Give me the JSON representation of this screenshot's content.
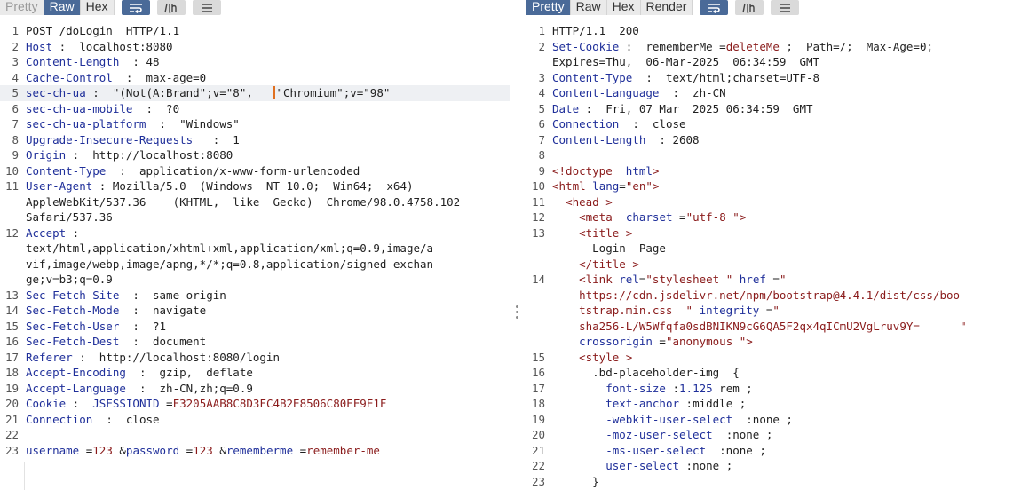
{
  "request": {
    "tabs": [
      "Pretty",
      "Raw",
      "Hex"
    ],
    "active_tab": "Raw",
    "lines": [
      {
        "no": "1",
        "segs": [
          {
            "t": "POST /doLogin  HTTP/1.1"
          }
        ]
      },
      {
        "no": "2",
        "segs": [
          {
            "t": "Host",
            "c": "hn"
          },
          {
            "t": " :  localhost:8080"
          }
        ]
      },
      {
        "no": "3",
        "segs": [
          {
            "t": "Content-Length",
            "c": "hn"
          },
          {
            "t": "  : 48"
          }
        ]
      },
      {
        "no": "4",
        "segs": [
          {
            "t": "Cache-Control",
            "c": "hn"
          },
          {
            "t": "  :  max-age=0"
          }
        ]
      },
      {
        "no": "5",
        "hl": true,
        "segs": [
          {
            "t": "sec-ch-ua",
            "c": "hn"
          },
          {
            "t": " :  \"(Not(A:Brand\";v=\"8\",   "
          },
          {
            "caret": true
          },
          {
            "t": "\"Chromium\";v=\"98\""
          }
        ]
      },
      {
        "no": "6",
        "segs": [
          {
            "t": "sec-ch-ua-mobile",
            "c": "hn"
          },
          {
            "t": "  :  ?0"
          }
        ]
      },
      {
        "no": "7",
        "segs": [
          {
            "t": "sec-ch-ua-platform",
            "c": "hn"
          },
          {
            "t": "  :  \"Windows\""
          }
        ]
      },
      {
        "no": "8",
        "segs": [
          {
            "t": "Upgrade-Insecure-Requests",
            "c": "hn"
          },
          {
            "t": "   :  1"
          }
        ]
      },
      {
        "no": "9",
        "segs": [
          {
            "t": "Origin",
            "c": "hn"
          },
          {
            "t": " :  http://localhost:8080"
          }
        ]
      },
      {
        "no": "10",
        "segs": [
          {
            "t": "Content-Type",
            "c": "hn"
          },
          {
            "t": "  :  application/x-www-form-urlencoded"
          }
        ]
      },
      {
        "no": "11",
        "segs": [
          {
            "t": "User-Agent",
            "c": "hn"
          },
          {
            "t": " : Mozilla/5.0  (Windows  NT 10.0;  Win64;  x64)"
          }
        ]
      },
      {
        "no": "",
        "segs": [
          {
            "t": "AppleWebKit/537.36    (KHTML,  like  Gecko)  Chrome/98.0.4758.102"
          }
        ]
      },
      {
        "no": "",
        "segs": [
          {
            "t": "Safari/537.36"
          }
        ]
      },
      {
        "no": "12",
        "segs": [
          {
            "t": "Accept",
            "c": "hn"
          },
          {
            "t": " :"
          }
        ]
      },
      {
        "no": "",
        "segs": [
          {
            "t": "text/html,application/xhtml+xml,application/xml;q=0.9,image/a"
          }
        ]
      },
      {
        "no": "",
        "segs": [
          {
            "t": "vif,image/webp,image/apng,*/*;q=0.8,application/signed-exchan"
          }
        ]
      },
      {
        "no": "",
        "segs": [
          {
            "t": "ge;v=b3;q=0.9"
          }
        ]
      },
      {
        "no": "13",
        "segs": [
          {
            "t": "Sec-Fetch-Site",
            "c": "hn"
          },
          {
            "t": "  :  same-origin"
          }
        ]
      },
      {
        "no": "14",
        "segs": [
          {
            "t": "Sec-Fetch-Mode",
            "c": "hn"
          },
          {
            "t": "  :  navigate"
          }
        ]
      },
      {
        "no": "15",
        "segs": [
          {
            "t": "Sec-Fetch-User",
            "c": "hn"
          },
          {
            "t": "  :  ?1"
          }
        ]
      },
      {
        "no": "16",
        "segs": [
          {
            "t": "Sec-Fetch-Dest",
            "c": "hn"
          },
          {
            "t": "  :  document"
          }
        ]
      },
      {
        "no": "17",
        "segs": [
          {
            "t": "Referer",
            "c": "hn"
          },
          {
            "t": " :  http://localhost:8080/login"
          }
        ]
      },
      {
        "no": "18",
        "segs": [
          {
            "t": "Accept-Encoding",
            "c": "hn"
          },
          {
            "t": "  :  gzip,  deflate"
          }
        ]
      },
      {
        "no": "19",
        "segs": [
          {
            "t": "Accept-Language",
            "c": "hn"
          },
          {
            "t": "  :  zh-CN,zh;q=0.9"
          }
        ]
      },
      {
        "no": "20",
        "segs": [
          {
            "t": "Cookie",
            "c": "hn"
          },
          {
            "t": " :  "
          },
          {
            "t": "JSESSIONID",
            "c": "hn"
          },
          {
            "t": " ="
          },
          {
            "t": "F3205AAB8C8D3FC4B2E8506C80EF9E1F",
            "c": "str"
          }
        ]
      },
      {
        "no": "21",
        "segs": [
          {
            "t": "Connection",
            "c": "hn"
          },
          {
            "t": "  :  close"
          }
        ]
      },
      {
        "no": "22",
        "segs": []
      },
      {
        "no": "23",
        "segs": [
          {
            "t": "username",
            "c": "hn"
          },
          {
            "t": " ="
          },
          {
            "t": "123",
            "c": "str"
          },
          {
            "t": " &"
          },
          {
            "t": "password",
            "c": "hn"
          },
          {
            "t": " ="
          },
          {
            "t": "123",
            "c": "str"
          },
          {
            "t": " &"
          },
          {
            "t": "rememberme",
            "c": "hn"
          },
          {
            "t": " ="
          },
          {
            "t": "remember-me",
            "c": "str"
          }
        ]
      }
    ]
  },
  "response": {
    "tabs": [
      "Pretty",
      "Raw",
      "Hex",
      "Render"
    ],
    "active_tab": "Pretty",
    "lines": [
      {
        "no": "1",
        "segs": [
          {
            "t": "HTTP/1.1  200"
          }
        ]
      },
      {
        "no": "2",
        "segs": [
          {
            "t": "Set-Cookie",
            "c": "hn"
          },
          {
            "t": " :  rememberMe ="
          },
          {
            "t": "deleteMe",
            "c": "str"
          },
          {
            "t": " ;  Path=/;  Max-Age=0;"
          }
        ]
      },
      {
        "no": "",
        "segs": [
          {
            "t": "Expires=Thu,  06-Mar-2025  06:34:59  GMT"
          }
        ]
      },
      {
        "no": "3",
        "segs": [
          {
            "t": "Content-Type",
            "c": "hn"
          },
          {
            "t": "  :  text/html;charset=UTF-8"
          }
        ]
      },
      {
        "no": "4",
        "segs": [
          {
            "t": "Content-Language",
            "c": "hn"
          },
          {
            "t": "  :  zh-CN"
          }
        ]
      },
      {
        "no": "5",
        "segs": [
          {
            "t": "Date",
            "c": "hn"
          },
          {
            "t": " :  Fri, 07 Mar  2025 06:34:59  GMT"
          }
        ]
      },
      {
        "no": "6",
        "segs": [
          {
            "t": "Connection",
            "c": "hn"
          },
          {
            "t": "  :  close"
          }
        ]
      },
      {
        "no": "7",
        "segs": [
          {
            "t": "Content-Length",
            "c": "hn"
          },
          {
            "t": "  : 2608"
          }
        ]
      },
      {
        "no": "8",
        "segs": []
      },
      {
        "no": "9",
        "segs": [
          {
            "t": "<!doctype",
            "c": "tag"
          },
          {
            "t": "  "
          },
          {
            "t": "html",
            "c": "att"
          },
          {
            "t": ">",
            "c": "tag"
          }
        ]
      },
      {
        "no": "10",
        "segs": [
          {
            "t": "<html",
            "c": "tag"
          },
          {
            "t": " "
          },
          {
            "t": "lang",
            "c": "att"
          },
          {
            "t": "="
          },
          {
            "t": "\"en\"",
            "c": "str"
          },
          {
            "t": ">",
            "c": "tag"
          }
        ]
      },
      {
        "no": "11",
        "segs": [
          {
            "t": "  "
          },
          {
            "t": "<head",
            "c": "tag"
          },
          {
            "t": " >",
            "c": "tag"
          }
        ]
      },
      {
        "no": "12",
        "segs": [
          {
            "t": "    "
          },
          {
            "t": "<meta",
            "c": "tag"
          },
          {
            "t": "  "
          },
          {
            "t": "charset",
            "c": "att"
          },
          {
            "t": " ="
          },
          {
            "t": "\"utf-8 \"",
            "c": "str"
          },
          {
            "t": ">",
            "c": "tag"
          }
        ]
      },
      {
        "no": "13",
        "segs": [
          {
            "t": "    "
          },
          {
            "t": "<title",
            "c": "tag"
          },
          {
            "t": " >",
            "c": "tag"
          }
        ]
      },
      {
        "no": "",
        "segs": [
          {
            "t": "      Login  Page"
          }
        ]
      },
      {
        "no": "",
        "segs": [
          {
            "t": "    "
          },
          {
            "t": "</title",
            "c": "tag"
          },
          {
            "t": " >",
            "c": "tag"
          }
        ]
      },
      {
        "no": "14",
        "segs": [
          {
            "t": "    "
          },
          {
            "t": "<link",
            "c": "tag"
          },
          {
            "t": " "
          },
          {
            "t": "rel",
            "c": "att"
          },
          {
            "t": "="
          },
          {
            "t": "\"stylesheet \"",
            "c": "str"
          },
          {
            "t": " "
          },
          {
            "t": "href",
            "c": "att"
          },
          {
            "t": " ="
          },
          {
            "t": "\"",
            "c": "str"
          }
        ]
      },
      {
        "no": "",
        "segs": [
          {
            "t": "    https://cdn.jsdelivr.net/npm/bootstrap@4.4.1/dist/css/boo",
            "c": "str"
          }
        ]
      },
      {
        "no": "",
        "segs": [
          {
            "t": "    tstrap.min.css  \"",
            "c": "str"
          },
          {
            "t": " "
          },
          {
            "t": "integrity",
            "c": "att"
          },
          {
            "t": " ="
          },
          {
            "t": "\"",
            "c": "str"
          }
        ]
      },
      {
        "no": "",
        "segs": [
          {
            "t": "    sha256-L/W5Wfqfa0sdBNIKN9cG6QA5F2qx4qICmU2VgLruv9Y=      \"",
            "c": "str"
          }
        ]
      },
      {
        "no": "",
        "segs": [
          {
            "t": "    "
          },
          {
            "t": "crossorigin",
            "c": "att"
          },
          {
            "t": " ="
          },
          {
            "t": "\"anonymous \"",
            "c": "str"
          },
          {
            "t": ">",
            "c": "tag"
          }
        ]
      },
      {
        "no": "15",
        "segs": [
          {
            "t": "    "
          },
          {
            "t": "<style",
            "c": "tag"
          },
          {
            "t": " >",
            "c": "tag"
          }
        ]
      },
      {
        "no": "16",
        "segs": [
          {
            "t": "      .bd-placeholder-img  {"
          }
        ]
      },
      {
        "no": "17",
        "segs": [
          {
            "t": "        "
          },
          {
            "t": "font-size",
            "c": "att"
          },
          {
            "t": " :"
          },
          {
            "t": "1.125",
            "c": "att"
          },
          {
            "t": " rem ;"
          }
        ]
      },
      {
        "no": "18",
        "segs": [
          {
            "t": "        "
          },
          {
            "t": "text-anchor",
            "c": "att"
          },
          {
            "t": " :middle ;"
          }
        ]
      },
      {
        "no": "19",
        "segs": [
          {
            "t": "        "
          },
          {
            "t": "-webkit-user-select",
            "c": "att"
          },
          {
            "t": "  :none ;"
          }
        ]
      },
      {
        "no": "20",
        "segs": [
          {
            "t": "        "
          },
          {
            "t": "-moz-user-select",
            "c": "att"
          },
          {
            "t": "  :none ;"
          }
        ]
      },
      {
        "no": "21",
        "segs": [
          {
            "t": "        "
          },
          {
            "t": "-ms-user-select",
            "c": "att"
          },
          {
            "t": "  :none ;"
          }
        ]
      },
      {
        "no": "22",
        "segs": [
          {
            "t": "        "
          },
          {
            "t": "user-select",
            "c": "att"
          },
          {
            "t": " :none ;"
          }
        ]
      },
      {
        "no": "23",
        "segs": [
          {
            "t": "      }"
          }
        ]
      }
    ]
  }
}
